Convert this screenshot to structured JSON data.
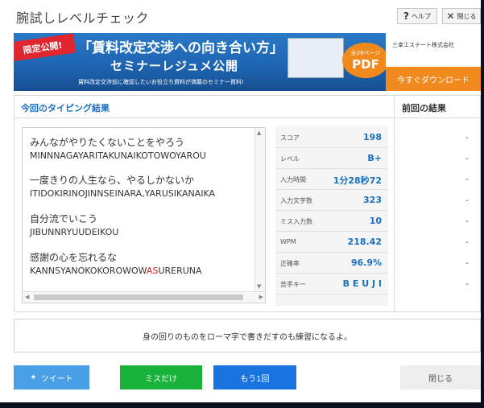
{
  "window": {
    "title": "腕試しレベルチェック",
    "help_label": "ヘルプ",
    "close_label": "閉じる"
  },
  "banner": {
    "ribbon": "限定公開!",
    "headline": "「賃料改定交渉への向き合い方」",
    "headline2": "セミナーレジュメ公開",
    "subline": "賃料改定交渉前に確認したいお役立ち資料が満載のセミナー資料!",
    "pdf_pages": "全26ページ",
    "pdf_label": "PDF",
    "company": "三幸エステート株式会社",
    "download": "今すぐダウンロード"
  },
  "results": {
    "current_header": "今回のタイピング結果",
    "previous_header": "前回の結果",
    "lines": [
      {
        "ja": "みんながやりたくないことをやろう",
        "ro": "MINNNAGAYARITAKUNAIKOTOWOYAROU"
      },
      {
        "ja": "一度きりの人生なら、やるしかないか",
        "ro": "ITIDOKIRINOJINNSEINARA,YARUSIKANAIKA"
      },
      {
        "ja": "自分流でいこう",
        "ro": "JIBUNNRYUUDEIKOU"
      },
      {
        "ja": "感謝の心を忘れるな",
        "ro_before": "KANNSYANOKOKOROWOW",
        "ro_miss": "AS",
        "ro_after": "URERUNA"
      }
    ],
    "stats": [
      {
        "label": "スコア",
        "value": "198",
        "prev": "-"
      },
      {
        "label": "レベル",
        "value": "B+",
        "prev": "-"
      },
      {
        "label": "入力時間",
        "value": "1分28秒72",
        "prev": "-"
      },
      {
        "label": "入力文字数",
        "value": "323",
        "prev": "-"
      },
      {
        "label": "ミス入力数",
        "value": "10",
        "prev": "-"
      },
      {
        "label": "WPM",
        "value": "218.42",
        "prev": "-"
      },
      {
        "label": "正確率",
        "value": "96.9%",
        "prev": "-"
      },
      {
        "label": "苦手キー",
        "value": "B E U J I",
        "prev": "-"
      }
    ]
  },
  "tip": "身の回りのものをローマ字で書きだすのも練習になるよ。",
  "buttons": {
    "tweet": "ツイート",
    "miss_only": "ミスだけ",
    "retry": "もう1回",
    "close": "閉じる"
  },
  "colors": {
    "accent": "#1a6fc2",
    "green": "#19b23a",
    "blue": "#1a74e0",
    "twitter": "#4aa0e6",
    "mistake": "#e02020"
  }
}
